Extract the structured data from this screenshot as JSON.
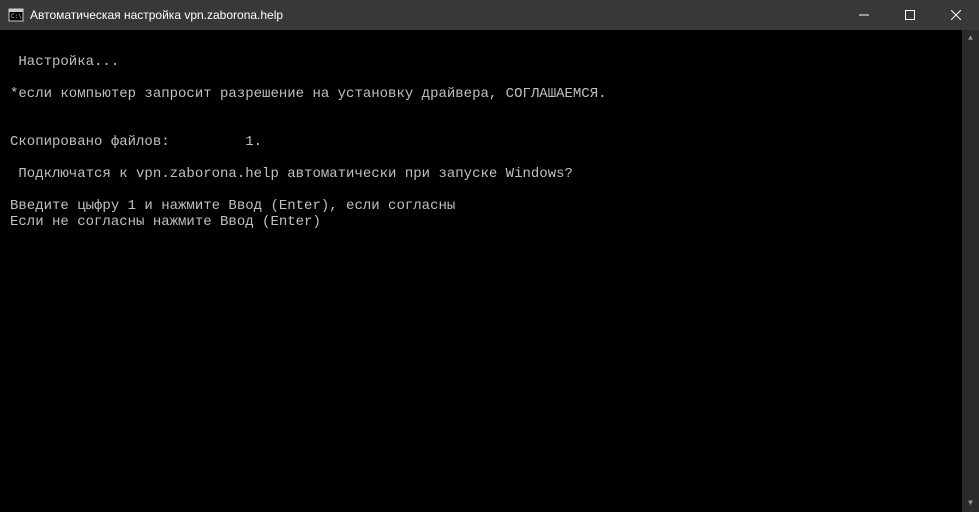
{
  "window": {
    "title": "Автоматическая настройка vpn.zaborona.help"
  },
  "console": {
    "lines": [
      "",
      " Настройка...",
      "",
      "*если компьютер запросит разрешение на установку драйвера, СОГЛАШАЕМСЯ.",
      "",
      "",
      "Скопировано файлов:         1.",
      "",
      " Подключатся к vpn.zaborona.help автоматически при запуске Windows?",
      "",
      "Введите цыфру 1 и нажмите Ввод (Enter), если согласны",
      "Если не согласны нажмите Ввод (Enter)"
    ]
  }
}
